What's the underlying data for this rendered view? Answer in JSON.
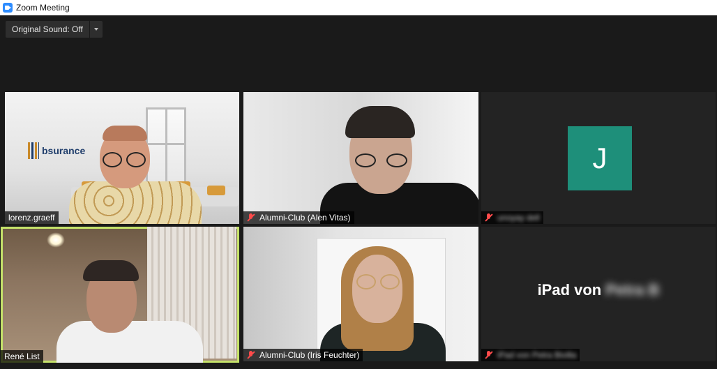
{
  "window": {
    "title": "Zoom Meeting"
  },
  "toolbar": {
    "original_sound_label": "Original Sound: Off"
  },
  "participants": [
    {
      "name": "lorenz.graeff",
      "muted": false
    },
    {
      "name": "Alumni-Club (Alen Vitas)",
      "muted": true
    },
    {
      "name": "unoyay dell",
      "muted": true,
      "avatar_letter": "J",
      "avatar_color": "#1e8f7a"
    },
    {
      "name": "René List",
      "muted": false,
      "active_speaker": true,
      "highlight_color": "#c5e26a"
    },
    {
      "name": "Alumni-Club (Iris Feuchter)",
      "muted": true
    },
    {
      "name": "iPad von Petra Bivilla",
      "muted": true,
      "display_name_visible": "iPad von",
      "display_name_blurred": "Petra B"
    }
  ],
  "scene_text": {
    "logo": "bsurance"
  },
  "icons": {
    "app": "zoom-video-icon",
    "mute": "mic-muted-icon",
    "dropdown": "chevron-down-icon"
  }
}
